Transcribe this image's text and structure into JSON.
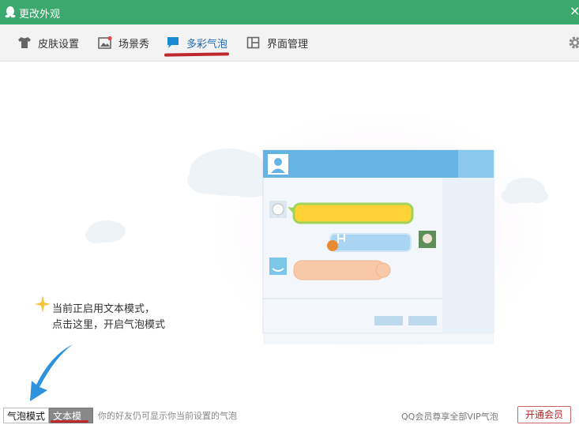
{
  "window": {
    "title": "更改外观",
    "close_glyph": "×"
  },
  "tabs": [
    {
      "label": "皮肤设置",
      "icon": "shirt-icon"
    },
    {
      "label": "场景秀",
      "icon": "picture-icon"
    },
    {
      "label": "多彩气泡",
      "icon": "chat-bubble-icon",
      "active": true
    },
    {
      "label": "界面管理",
      "icon": "layout-icon"
    }
  ],
  "hint": {
    "line1": "当前正启用文本模式，",
    "line2": "点击这里，开启气泡模式"
  },
  "bottom": {
    "bubble_mode": "气泡模式",
    "text_mode": "文本模式",
    "note": "你的好友仍可显示你当前设置的气泡",
    "vip_note": "QQ会员尊享全部VIP气泡",
    "open_vip": "开通会员"
  },
  "colors": {
    "titlebar": "#3aa96b",
    "accent": "#1d6bb5",
    "underline": "#c0282d"
  }
}
